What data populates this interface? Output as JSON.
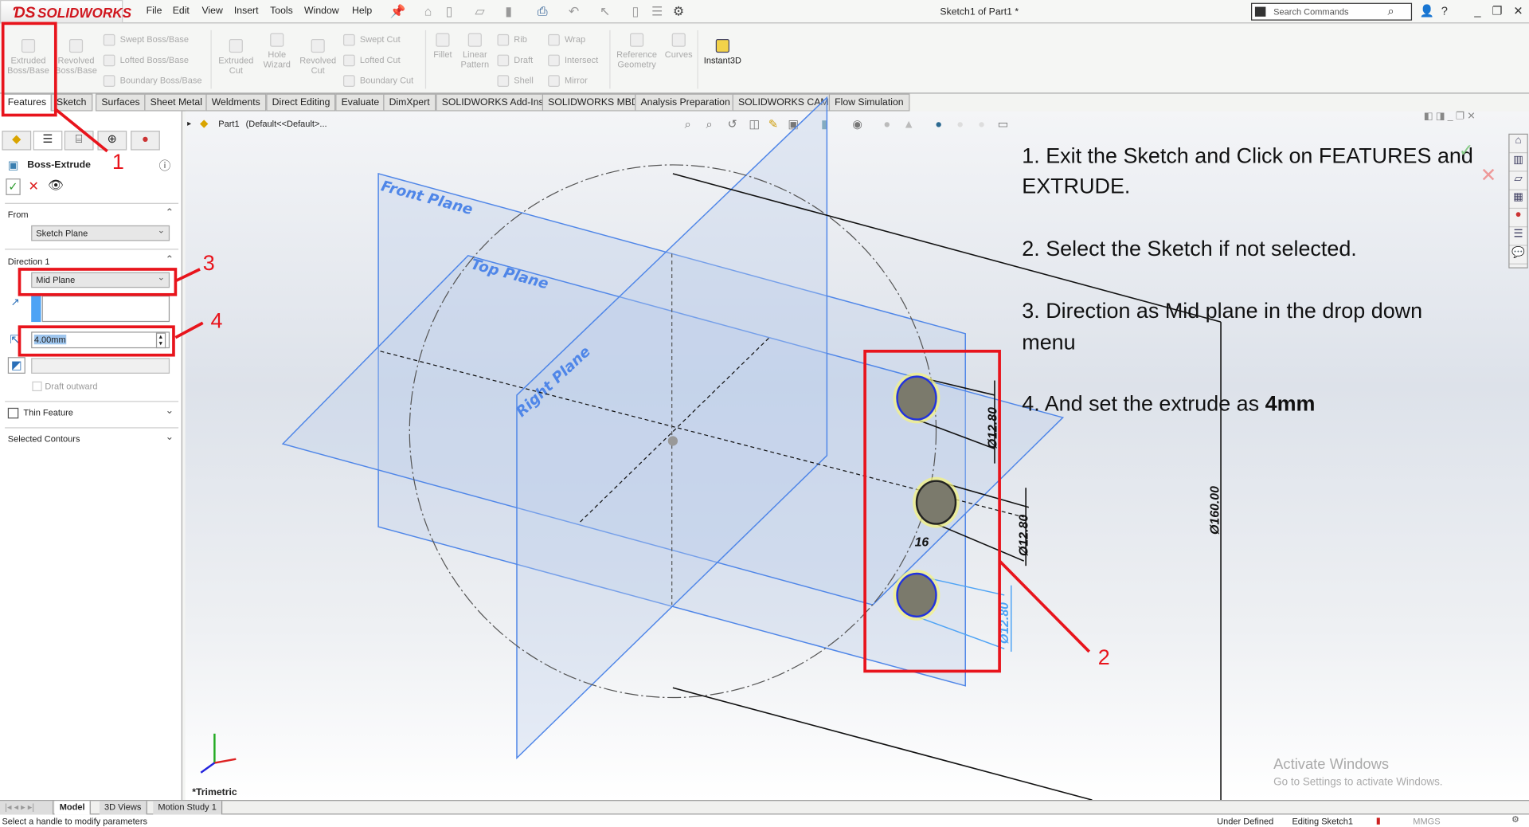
{
  "app": {
    "logo": "SOLIDWORKS",
    "title": "Sketch1 of Part1 *",
    "search_placeholder": "Search Commands"
  },
  "menu": [
    "File",
    "Edit",
    "View",
    "Insert",
    "Tools",
    "Window",
    "Help"
  ],
  "ribbon": {
    "extruded_boss": "Extruded Boss/Base",
    "revolved_boss": "Revolved Boss/Base",
    "swept_boss": "Swept Boss/Base",
    "lofted_boss": "Lofted Boss/Base",
    "boundary_boss": "Boundary Boss/Base",
    "extruded_cut": "Extruded Cut",
    "hole_wizard": "Hole Wizard",
    "revolved_cut": "Revolved Cut",
    "swept_cut": "Swept Cut",
    "lofted_cut": "Lofted Cut",
    "boundary_cut": "Boundary Cut",
    "fillet": "Fillet",
    "linear_pattern": "Linear Pattern",
    "rib": "Rib",
    "draft": "Draft",
    "shell": "Shell",
    "wrap": "Wrap",
    "intersect": "Intersect",
    "mirror": "Mirror",
    "reference_geometry": "Reference Geometry",
    "curves": "Curves",
    "instant3d": "Instant3D"
  },
  "tabs": [
    "Features",
    "Sketch",
    "Surfaces",
    "Sheet Metal",
    "Weldments",
    "Direct Editing",
    "Evaluate",
    "DimXpert",
    "SOLIDWORKS Add-Ins",
    "SOLIDWORKS MBD",
    "Analysis Preparation",
    "SOLIDWORKS CAM",
    "Flow Simulation"
  ],
  "panel": {
    "title": "Boss-Extrude",
    "from_label": "From",
    "from_value": "Sketch Plane",
    "direction_label": "Direction 1",
    "direction_value": "Mid Plane",
    "depth_value": "4.00mm",
    "draft_outward": "Draft outward",
    "thin_feature": "Thin Feature",
    "selected_contours": "Selected Contours"
  },
  "tree": {
    "part": "Part1",
    "config": "(Default<<Default>..."
  },
  "viewport": {
    "front_plane": "Front Plane",
    "top_plane": "Top Plane",
    "right_plane": "Right Plane",
    "dim_large": "Ø160.00",
    "dim_hole1": "Ø12.80",
    "dim_hole2": "Ø12.80",
    "dim_hole3": "Ø12.80",
    "count": "16",
    "view_name": "*Trimetric",
    "activate_title": "Activate Windows",
    "activate_sub": "Go to Settings to activate Windows."
  },
  "instructions": {
    "l1a": "1. Exit the Sketch and Click on FEATURES and",
    "l1b": "EXTRUDE.",
    "l2": "2. Select the Sketch if not selected.",
    "l3a": "3. Direction as Mid plane in the drop down",
    "l3b": "menu",
    "l4": "4. And set the extrude as ",
    "l4b": "4mm"
  },
  "annotations": {
    "n1": "1",
    "n2": "2",
    "n3": "3",
    "n4": "4",
    "color": "#e8141c"
  },
  "bottom_tabs": [
    "Model",
    "3D Views",
    "Motion Study 1"
  ],
  "status": {
    "message": "Select a handle to modify parameters",
    "state": "Under Defined",
    "editing": "Editing Sketch1",
    "units": "MMGS"
  }
}
